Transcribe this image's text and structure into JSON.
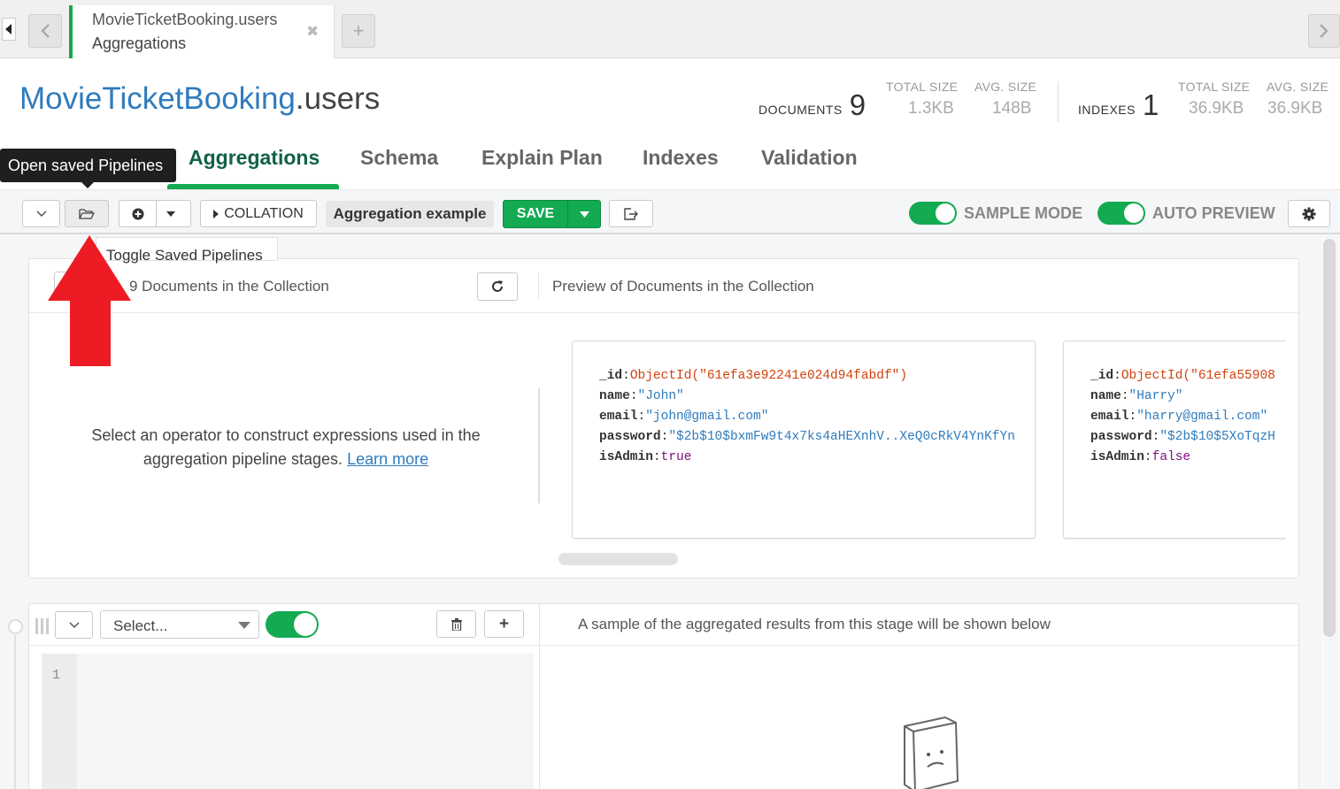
{
  "tab": {
    "title_line1": "MovieTicketBooking.users",
    "title_line2": "Aggregations",
    "close": "✖",
    "add": "+"
  },
  "header": {
    "db": "MovieTicketBooking",
    "collection": ".users",
    "documents_label": "DOCUMENTS",
    "documents_count": "9",
    "doc_total_size_label": "TOTAL SIZE",
    "doc_total_size": "1.3KB",
    "doc_avg_size_label": "AVG. SIZE",
    "doc_avg_size": "148B",
    "indexes_label": "INDEXES",
    "indexes_count": "1",
    "idx_total_size_label": "TOTAL SIZE",
    "idx_total_size": "36.9KB",
    "idx_avg_size_label": "AVG. SIZE",
    "idx_avg_size": "36.9KB"
  },
  "nav": {
    "tooltip": "Open saved Pipelines",
    "tabs": [
      "Aggregations",
      "Schema",
      "Explain Plan",
      "Indexes",
      "Validation"
    ]
  },
  "toolbar": {
    "collation": "COLLATION",
    "pipeline_name": "Aggregation example",
    "save": "SAVE",
    "sample_mode": "SAMPLE MODE",
    "auto_preview": "AUTO PREVIEW",
    "tooltip_toggle": "Toggle Saved Pipelines"
  },
  "source": {
    "doc_count": "9 Documents in the Collection",
    "preview_label": "Preview of Documents in the Collection",
    "help_text_1": "Select an operator to construct expressions used in the",
    "help_text_2": "aggregation pipeline stages.",
    "learn_more": "Learn more"
  },
  "documents": [
    {
      "id_key": "_id",
      "id_val": "ObjectId(\"61efa3e92241e024d94fabdf\")",
      "name_key": "name",
      "name_val": "\"John\"",
      "email_key": "email",
      "email_val": "\"john@gmail.com\"",
      "password_key": "password",
      "password_val": "\"$2b$10$bxmFw9t4x7ks4aHEXnhV..XeQ0cRkV4YnKfYn",
      "admin_key": "isAdmin",
      "admin_val": "true"
    },
    {
      "id_key": "_id",
      "id_val": "ObjectId(\"61efa55908",
      "name_key": "name",
      "name_val": "\"Harry\"",
      "email_key": "email",
      "email_val": "\"harry@gmail.com\"",
      "password_key": "password",
      "password_val": "\"$2b$10$5XoTqzH",
      "admin_key": "isAdmin",
      "admin_val": "false"
    }
  ],
  "stage": {
    "select_placeholder": "Select...",
    "result_text": "A sample of the aggregated results from this stage will be shown below",
    "line_number": "1"
  },
  "colors": {
    "green": "#13aa52",
    "blue": "#2f7bbd",
    "arrow": "#ed1c24"
  }
}
